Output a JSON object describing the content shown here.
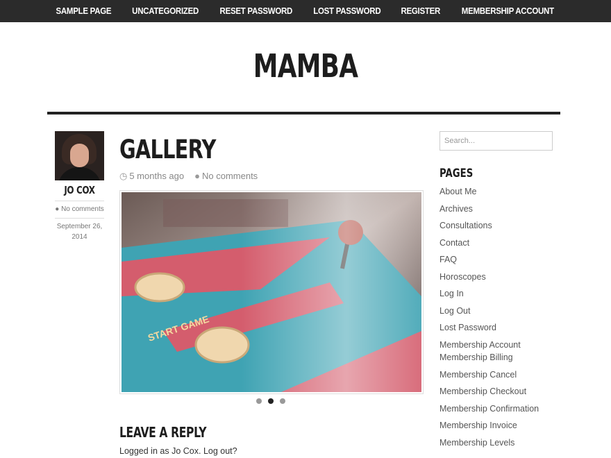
{
  "nav": {
    "items": [
      "SAMPLE PAGE",
      "UNCATEGORIZED",
      "RESET PASSWORD",
      "LOST PASSWORD",
      "REGISTER",
      "MEMBERSHIP ACCOUNT"
    ]
  },
  "site": {
    "title": "MAMBA"
  },
  "author": {
    "name": "JO COX",
    "comments": "No comments",
    "date_line1": "September 26,",
    "date_line2": "2014"
  },
  "post": {
    "title": "GALLERY",
    "time": "5 months ago",
    "comments": "No comments",
    "gallery_active_index": 1,
    "gallery_count": 3
  },
  "reply": {
    "title": "LEAVE A REPLY",
    "logged_prefix": "Logged in as",
    "user": "Jo Cox.",
    "logout": "Log out?"
  },
  "sidebar": {
    "search_placeholder": "Search...",
    "pages_title": "PAGES",
    "pages": [
      "About Me",
      "Archives",
      "Consultations",
      "Contact",
      "FAQ",
      "Horoscopes",
      "Log In",
      "Log Out",
      "Lost Password",
      "Membership Account",
      "Membership Billing",
      "Membership Cancel",
      "Membership Checkout",
      "Membership Confirmation",
      "Membership Invoice",
      "Membership Levels"
    ]
  },
  "icons": {
    "clock": "clock-icon",
    "comment": "comment-icon"
  }
}
